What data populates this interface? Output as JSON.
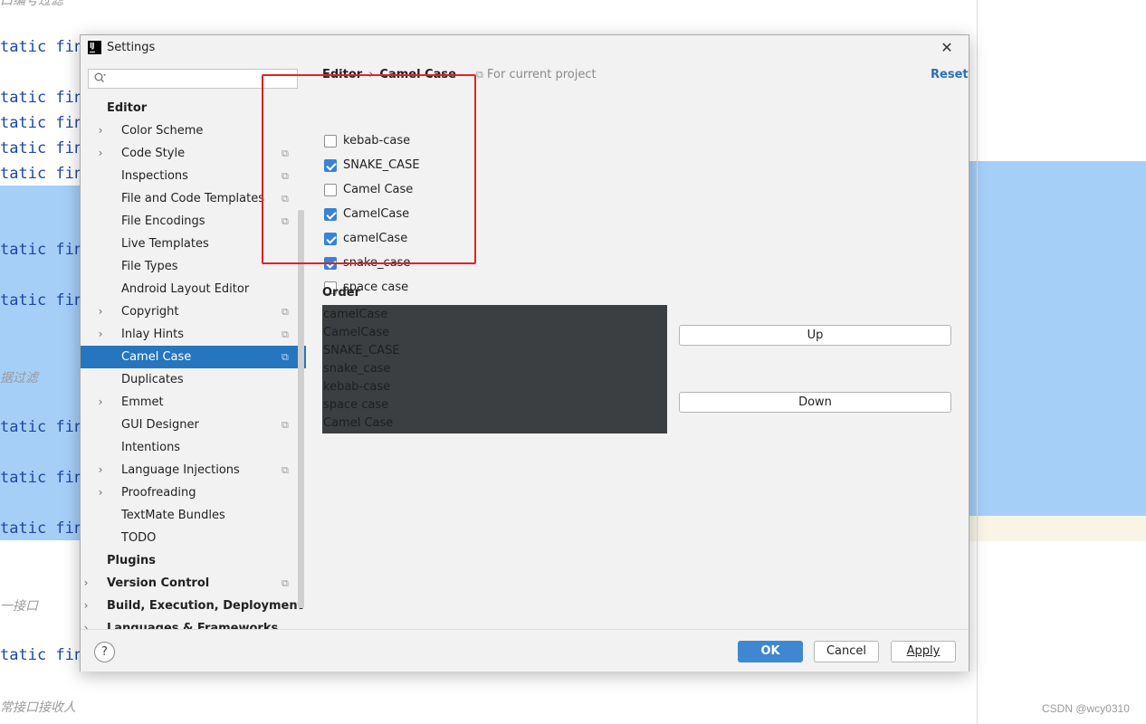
{
  "background": {
    "code_lines": [
      "tatic fin",
      "tatic fin",
      "tatic fin",
      "tatic fin",
      "tatic fin",
      "tatic fin",
      "tatic fin",
      "tatic fin",
      "tatic fin",
      "tatic fin",
      "tatic fin"
    ],
    "comments": [
      "口编号过滤",
      "据过滤",
      "一接口",
      "常接口接收人"
    ],
    "watermark": "CSDN @wcy0310"
  },
  "dialog": {
    "title": "Settings",
    "close_glyph": "✕",
    "search": {
      "placeholder": "",
      "icon": "search-icon"
    },
    "tree": [
      {
        "label": "Editor",
        "bold": true,
        "level": 0,
        "chevron": false,
        "project": false
      },
      {
        "label": "Color Scheme",
        "level": 1,
        "chevron": true,
        "project": false
      },
      {
        "label": "Code Style",
        "level": 1,
        "chevron": true,
        "project": true
      },
      {
        "label": "Inspections",
        "level": 1,
        "chevron": false,
        "project": true
      },
      {
        "label": "File and Code Templates",
        "level": 1,
        "chevron": false,
        "project": true
      },
      {
        "label": "File Encodings",
        "level": 1,
        "chevron": false,
        "project": true
      },
      {
        "label": "Live Templates",
        "level": 1,
        "chevron": false,
        "project": false
      },
      {
        "label": "File Types",
        "level": 1,
        "chevron": false,
        "project": false
      },
      {
        "label": "Android Layout Editor",
        "level": 1,
        "chevron": false,
        "project": false
      },
      {
        "label": "Copyright",
        "level": 1,
        "chevron": true,
        "project": true
      },
      {
        "label": "Inlay Hints",
        "level": 1,
        "chevron": true,
        "project": true
      },
      {
        "label": "Camel Case",
        "level": 1,
        "chevron": false,
        "project": true,
        "selected": true
      },
      {
        "label": "Duplicates",
        "level": 1,
        "chevron": false,
        "project": false
      },
      {
        "label": "Emmet",
        "level": 1,
        "chevron": true,
        "project": false
      },
      {
        "label": "GUI Designer",
        "level": 1,
        "chevron": false,
        "project": true
      },
      {
        "label": "Intentions",
        "level": 1,
        "chevron": false,
        "project": false
      },
      {
        "label": "Language Injections",
        "level": 1,
        "chevron": true,
        "project": true
      },
      {
        "label": "Proofreading",
        "level": 1,
        "chevron": true,
        "project": false
      },
      {
        "label": "TextMate Bundles",
        "level": 1,
        "chevron": false,
        "project": false
      },
      {
        "label": "TODO",
        "level": 1,
        "chevron": false,
        "project": false
      },
      {
        "label": "Plugins",
        "bold": true,
        "level": 0,
        "chevron": false,
        "project": false
      },
      {
        "label": "Version Control",
        "bold": true,
        "level": 0,
        "chevron": true,
        "project": true
      },
      {
        "label": "Build, Execution, Deployment",
        "bold": true,
        "level": 0,
        "chevron": true,
        "project": false
      },
      {
        "label": "Languages & Frameworks",
        "bold": true,
        "level": 0,
        "chevron": true,
        "project": false
      }
    ],
    "breadcrumb": {
      "parent": "Editor",
      "separator": "›",
      "current": "Camel Case"
    },
    "for_current_project": "For current project",
    "reset": "Reset",
    "checkboxes": [
      {
        "label": "kebab-case",
        "checked": false
      },
      {
        "label": "SNAKE_CASE",
        "checked": true
      },
      {
        "label": "Camel Case",
        "checked": false
      },
      {
        "label": "CamelCase",
        "checked": true
      },
      {
        "label": "camelCase",
        "checked": true
      },
      {
        "label": "snake_case",
        "checked": true
      },
      {
        "label": "space case",
        "checked": false
      }
    ],
    "order_label": "Order",
    "order": [
      "camelCase",
      "CamelCase",
      "SNAKE_CASE",
      "snake_case",
      "kebab-case",
      "space case",
      "Camel Case"
    ],
    "up_button": "Up",
    "down_button": "Down",
    "help": "?",
    "ok": "OK",
    "cancel": "Cancel",
    "apply": "Apply",
    "colors": {
      "selection": "#2675bf",
      "primary_button": "#3f87d0",
      "link": "#2a6fbd",
      "annotation": "#e32222"
    }
  }
}
